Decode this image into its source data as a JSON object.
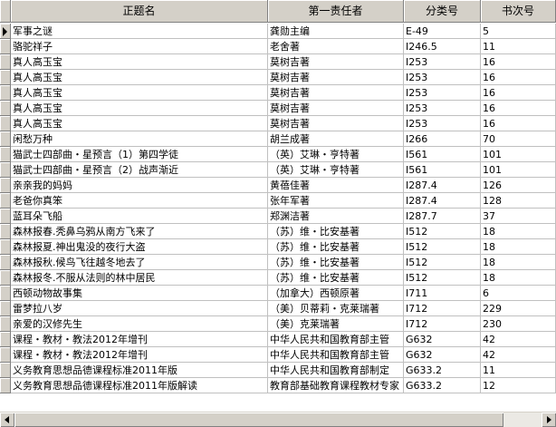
{
  "columns": [
    "正题名",
    "第一责任者",
    "分类号",
    "书次号"
  ],
  "rows": [
    [
      "军事之谜",
      "龚勋主编",
      "E-49",
      "5"
    ],
    [
      "骆驼祥子",
      "老舍著",
      "I246.5",
      "11"
    ],
    [
      "真人高玉宝",
      "莫树吉著",
      "I253",
      "16"
    ],
    [
      "真人高玉宝",
      "莫树吉著",
      "I253",
      "16"
    ],
    [
      "真人高玉宝",
      "莫树吉著",
      "I253",
      "16"
    ],
    [
      "真人高玉宝",
      "莫树吉著",
      "I253",
      "16"
    ],
    [
      "真人高玉宝",
      "莫树吉著",
      "I253",
      "16"
    ],
    [
      "闲愁万种",
      "胡兰成著",
      "I266",
      "70"
    ],
    [
      "猫武士四部曲・星预言（1）第四学徒",
      "（英）艾琳・亨特著",
      "I561",
      "101"
    ],
    [
      "猫武士四部曲・星预言（2）战声渐近",
      "（英）艾琳・亨特著",
      "I561",
      "101"
    ],
    [
      "亲亲我的妈妈",
      "黄蓓佳著",
      "I287.4",
      "126"
    ],
    [
      "老爸你真笨",
      "张年军著",
      "I287.4",
      "128"
    ],
    [
      "蓝耳朵飞船",
      "郑渊洁著",
      "I287.7",
      "37"
    ],
    [
      "森林报春.秃鼻乌鸦从南方飞来了",
      "（苏）维・比安基著",
      "I512",
      "18"
    ],
    [
      "森林报夏.神出鬼没的夜行大盗",
      "（苏）维・比安基著",
      "I512",
      "18"
    ],
    [
      "森林报秋.候鸟飞往越冬地去了",
      "（苏）维・比安基著",
      "I512",
      "18"
    ],
    [
      "森林报冬.不服从法则的林中居民",
      "（苏）维・比安基著",
      "I512",
      "18"
    ],
    [
      "西顿动物故事集",
      "（加拿大）西顿原著",
      "I711",
      "6"
    ],
    [
      "雷梦拉八岁",
      "（美）贝蒂莉・克莱瑞著",
      "I712",
      "229"
    ],
    [
      "亲爱的汉修先生",
      "（美）克莱瑞著",
      "I712",
      "230"
    ],
    [
      "课程・教材・教法2012年增刊",
      "中华人民共和国教育部主管",
      "G632",
      "42"
    ],
    [
      "课程・教材・教法2012年增刊",
      "中华人民共和国教育部主管",
      "G632",
      "42"
    ],
    [
      "义务教育思想品德课程标准2011年版",
      "中华人民共和国教育部制定",
      "G633.2",
      "11"
    ],
    [
      "义务教育思想品德课程标准2011年版解读",
      "教育部基础教育课程教材专家",
      "G633.2",
      "12"
    ]
  ]
}
